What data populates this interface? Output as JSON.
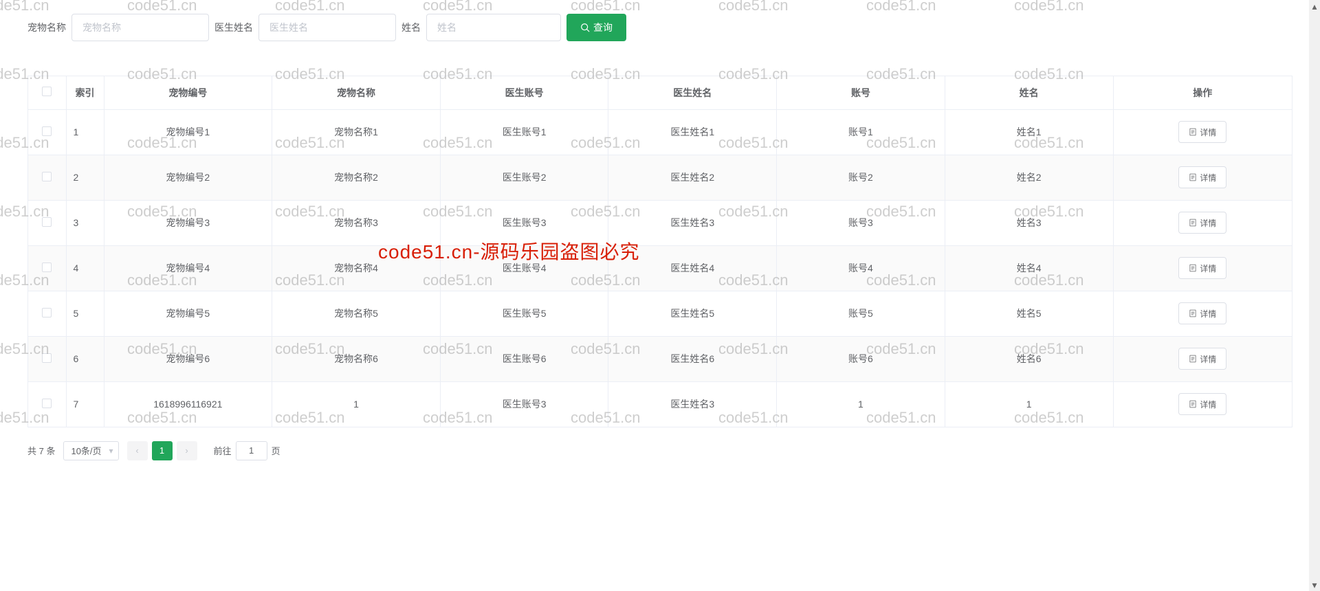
{
  "search": {
    "fields": [
      {
        "label": "宠物名称",
        "placeholder": "宠物名称",
        "value": ""
      },
      {
        "label": "医生姓名",
        "placeholder": "医生姓名",
        "value": ""
      },
      {
        "label": "姓名",
        "placeholder": "姓名",
        "value": ""
      }
    ],
    "query_button": "查询"
  },
  "table": {
    "headers": [
      "索引",
      "宠物编号",
      "宠物名称",
      "医生账号",
      "医生姓名",
      "账号",
      "姓名",
      "操作"
    ],
    "detail_button": "详情",
    "rows": [
      {
        "index": "1",
        "pet_no": "宠物编号1",
        "pet_name": "宠物名称1",
        "doctor_acc": "医生账号1",
        "doctor_name": "医生姓名1",
        "account": "账号1",
        "name": "姓名1"
      },
      {
        "index": "2",
        "pet_no": "宠物编号2",
        "pet_name": "宠物名称2",
        "doctor_acc": "医生账号2",
        "doctor_name": "医生姓名2",
        "account": "账号2",
        "name": "姓名2"
      },
      {
        "index": "3",
        "pet_no": "宠物编号3",
        "pet_name": "宠物名称3",
        "doctor_acc": "医生账号3",
        "doctor_name": "医生姓名3",
        "account": "账号3",
        "name": "姓名3"
      },
      {
        "index": "4",
        "pet_no": "宠物编号4",
        "pet_name": "宠物名称4",
        "doctor_acc": "医生账号4",
        "doctor_name": "医生姓名4",
        "account": "账号4",
        "name": "姓名4"
      },
      {
        "index": "5",
        "pet_no": "宠物编号5",
        "pet_name": "宠物名称5",
        "doctor_acc": "医生账号5",
        "doctor_name": "医生姓名5",
        "account": "账号5",
        "name": "姓名5"
      },
      {
        "index": "6",
        "pet_no": "宠物编号6",
        "pet_name": "宠物名称6",
        "doctor_acc": "医生账号6",
        "doctor_name": "医生姓名6",
        "account": "账号6",
        "name": "姓名6"
      },
      {
        "index": "7",
        "pet_no": "1618996116921",
        "pet_name": "1",
        "doctor_acc": "医生账号3",
        "doctor_name": "医生姓名3",
        "account": "1",
        "name": "1"
      }
    ]
  },
  "pagination": {
    "total_text": "共 7 条",
    "page_size": "10条/页",
    "current": "1",
    "jump_prefix": "前往",
    "jump_value": "1",
    "jump_suffix": "页"
  },
  "watermark": {
    "text": "code51.cn",
    "center": "code51.cn-源码乐园盗图必究"
  }
}
